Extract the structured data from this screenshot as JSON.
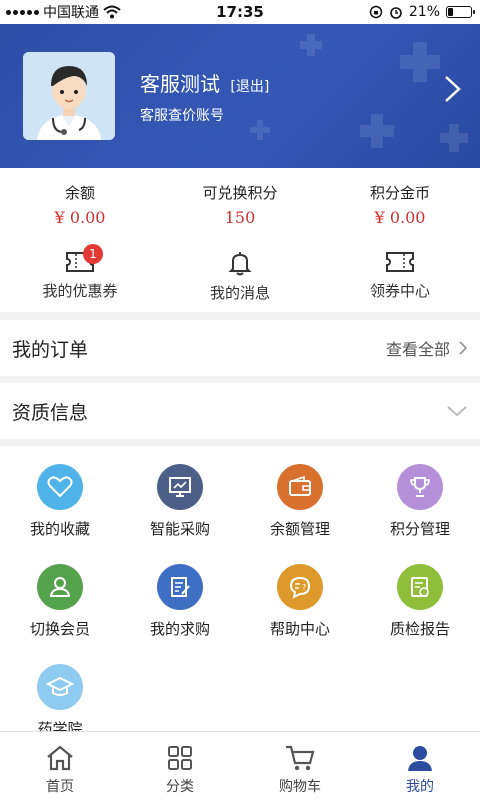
{
  "status_bar": {
    "carrier": "中国联通",
    "time": "17:35",
    "battery": "21%",
    "battery_level": 0.21
  },
  "header": {
    "user_name": "客服测试",
    "logout_label": "[退出]",
    "account_type": "客服查价账号"
  },
  "stats": [
    {
      "label": "余额",
      "value": "¥ 0.00"
    },
    {
      "label": "可兑换积分",
      "value": "150"
    },
    {
      "label": "积分金币",
      "value": "¥ 0.00"
    }
  ],
  "quick_links": [
    {
      "label": "我的优惠券",
      "badge": "1",
      "icon": "coupon-icon"
    },
    {
      "label": "我的消息",
      "icon": "bell-icon"
    },
    {
      "label": "领券中心",
      "icon": "ticket-icon"
    }
  ],
  "orders": {
    "title": "我的订单",
    "view_all": "查看全部"
  },
  "qualification": {
    "title": "资质信息"
  },
  "grid": [
    {
      "label": "我的收藏",
      "color": "#4fb3ea",
      "icon": "heart-icon"
    },
    {
      "label": "智能采购",
      "color": "#4c5f86",
      "icon": "chart-board-icon"
    },
    {
      "label": "余额管理",
      "color": "#d8702e",
      "icon": "wallet-icon"
    },
    {
      "label": "积分管理",
      "color": "#b58fd8",
      "icon": "trophy-icon"
    },
    {
      "label": "切换会员",
      "color": "#54a24b",
      "icon": "member-switch-icon"
    },
    {
      "label": "我的求购",
      "color": "#3f6fc2",
      "icon": "edit-list-icon"
    },
    {
      "label": "帮助中心",
      "color": "#dd9a2a",
      "icon": "help-chat-icon"
    },
    {
      "label": "质检报告",
      "color": "#8fbf3a",
      "icon": "report-icon"
    },
    {
      "label": "药学院",
      "color": "#8fcaf0",
      "icon": "graduation-cap-icon"
    }
  ],
  "tabs": [
    {
      "label": "首页",
      "icon": "home-icon"
    },
    {
      "label": "分类",
      "icon": "grid-icon"
    },
    {
      "label": "购物车",
      "icon": "cart-icon"
    },
    {
      "label": "我的",
      "icon": "profile-icon",
      "active": true
    }
  ]
}
